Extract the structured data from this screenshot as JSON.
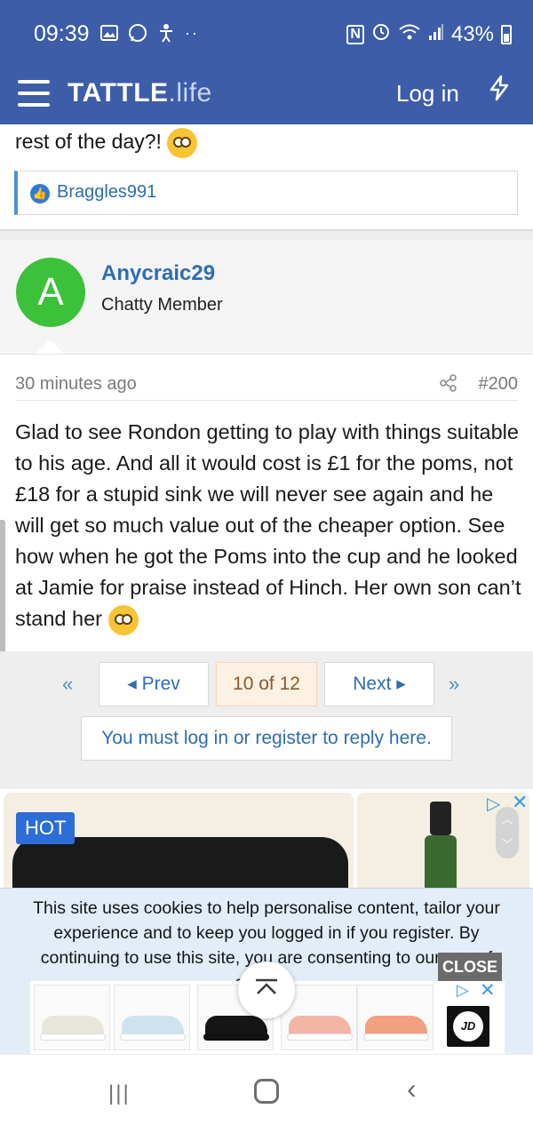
{
  "status_bar": {
    "time": "09:39",
    "left_icons": [
      "image-icon",
      "whatsapp-icon",
      "accessibility-icon"
    ],
    "dots": "··",
    "nfc": "N",
    "battery_pct": "43%"
  },
  "header": {
    "logo_main": "TATTLE",
    "logo_sub": ".life",
    "login_label": "Log in",
    "colors": {
      "brand": "#3d5da8"
    }
  },
  "previous_post": {
    "tail_text": "rest of the day?!",
    "liked_by": "Braggles991"
  },
  "post": {
    "avatar_letter": "A",
    "username": "Anycraic29",
    "user_title": "Chatty Member",
    "time_ago": "30 minutes ago",
    "post_number": "#200",
    "body": "Glad to see Rondon getting to play with things suitable to his age. And all it would cost is £1 for the poms, not £18 for a stupid sink we will never see again and he will get so much value out of the cheaper option. See how when he got the Poms into the cup and he looked at Jamie for praise instead of Hinch. Her own son can’t stand her"
  },
  "pagination": {
    "prev_label": "◂ Prev",
    "current": "10 of 12",
    "next_label": "Next ▸",
    "first_icon": "«",
    "last_icon": "»",
    "reply_prompt": "You must log in or register to reply here."
  },
  "ad": {
    "badge": "HOT",
    "close": "✕"
  },
  "cookie": {
    "text": "This site uses cookies to help personalise content, tailor your experience and to keep you logged in if you register. By continuing to use this site, you are consenting to our use of cookies.",
    "close_label": "CLOSE"
  },
  "ad_strip": {
    "brand": "JD",
    "shoe_colors": [
      "#e8e6da",
      "#cfe3ef",
      "#151515",
      "#f3b5a5",
      "#f2a07f"
    ]
  },
  "nav": {
    "recent": "|||",
    "back": "‹"
  }
}
